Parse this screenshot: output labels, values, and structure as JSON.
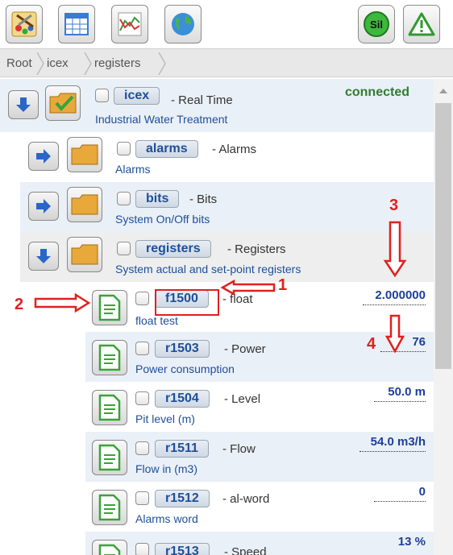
{
  "toolbar": {
    "buttons": [
      {
        "icon": "paint-palette-icon"
      },
      {
        "icon": "table-grid-icon"
      },
      {
        "icon": "chart-icon"
      },
      {
        "icon": "globe-icon"
      }
    ],
    "right_buttons": [
      {
        "icon": "sil-icon",
        "label": "Sil"
      },
      {
        "icon": "warning-icon"
      }
    ]
  },
  "breadcrumb": [
    "Root",
    "icex",
    "registers"
  ],
  "tree": {
    "root": {
      "tag": "icex",
      "title": "- Real Time",
      "desc": "Industrial Water Treatment",
      "status": "connected"
    },
    "folders": [
      {
        "tag": "alarms",
        "title": "- Alarms",
        "desc": "Alarms"
      },
      {
        "tag": "bits",
        "title": "- Bits",
        "desc": "System On/Off bits"
      },
      {
        "tag": "registers",
        "title": "- Registers",
        "desc": "System actual and set-point registers"
      }
    ],
    "registers": [
      {
        "tag": "f1500",
        "title": "- float",
        "desc": "float test",
        "value": "2.000000"
      },
      {
        "tag": "r1503",
        "title": "- Power",
        "desc": "Power consumption",
        "value": "76"
      },
      {
        "tag": "r1504",
        "title": "- Level",
        "desc": "Pit level (m)",
        "value": "50.0 m"
      },
      {
        "tag": "r1511",
        "title": "- Flow",
        "desc": "Flow in (m3)",
        "value": "54.0 m3/h"
      },
      {
        "tag": "r1512",
        "title": "- al-word",
        "desc": "Alarms word",
        "value": "0"
      },
      {
        "tag": "r1513",
        "title": "- Speed",
        "desc": "",
        "value": "13 %"
      }
    ]
  },
  "annotations": {
    "labels": [
      "1",
      "2",
      "3",
      "4"
    ],
    "color": "#e02020"
  },
  "colors": {
    "accent_blue": "#1d4f9b",
    "connected_green": "#2e7d2e",
    "annotation_red": "#e02020"
  }
}
